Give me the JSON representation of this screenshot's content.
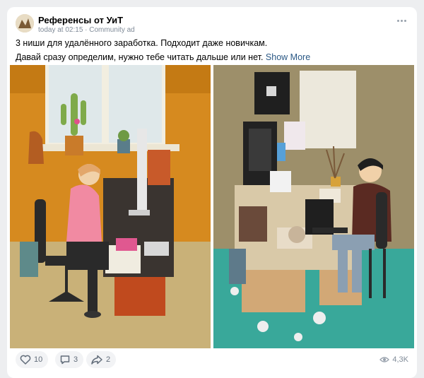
{
  "post": {
    "author": "Референсы от УиТ",
    "meta": "today at 02:15 · Community ad",
    "line1": "3 ниши для удалённого заработка. Подходит даже новичкам.",
    "line2": "Давай сразу определим, нужно тебе читать дальше или нет.",
    "show_more": "Show More"
  },
  "actions": {
    "likes": "10",
    "comments": "3",
    "shares": "2",
    "views": "4,3K"
  },
  "colors": {
    "accent_link": "#2a5885",
    "muted": "#818c99",
    "action_bg": "#f2f3f5"
  }
}
